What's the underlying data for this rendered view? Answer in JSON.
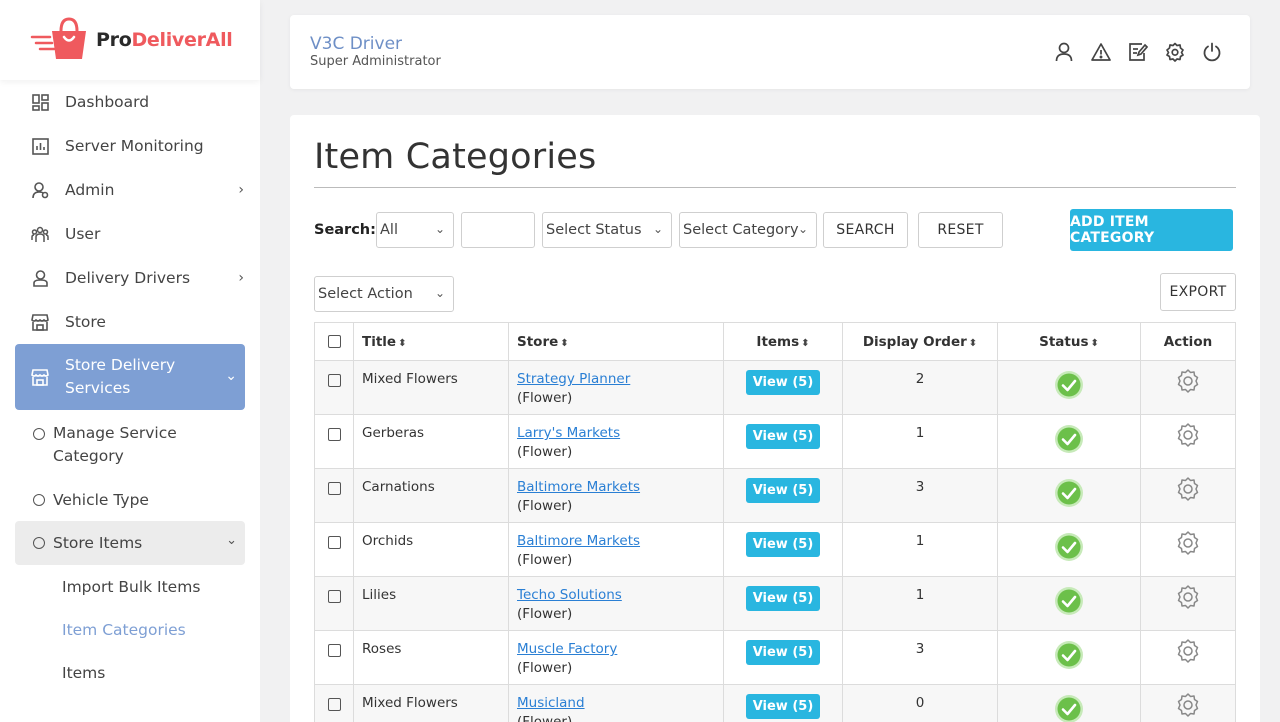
{
  "brand": {
    "part1": "Pro",
    "part2": "DeliverAll"
  },
  "sidebar": {
    "items": [
      {
        "label": "Dashboard",
        "icon": "dashboard-icon"
      },
      {
        "label": "Server Monitoring",
        "icon": "chart-icon"
      },
      {
        "label": "Admin",
        "icon": "admin-user-icon"
      },
      {
        "label": "User",
        "icon": "users-icon"
      },
      {
        "label": "Delivery Drivers",
        "icon": "driver-icon"
      },
      {
        "label": "Store",
        "icon": "store-icon"
      },
      {
        "label": "Store Delivery Services",
        "icon": "store-icon"
      }
    ],
    "sub": {
      "manage_service_category_1": "Manage Service",
      "manage_service_category_2": "Category",
      "vehicle_type": "Vehicle Type",
      "store_items": "Store Items"
    },
    "subsub": {
      "import_bulk_items": "Import Bulk Items",
      "item_categories": "Item Categories",
      "items": "Items"
    }
  },
  "header": {
    "user_name": "V3C Driver",
    "user_role": "Super Administrator"
  },
  "main": {
    "title": "Item Categories",
    "search_label": "Search:",
    "filter_all": "All",
    "search_placeholder": "",
    "select_status": "Select Status",
    "select_category": "Select Category",
    "search_button": "SEARCH",
    "reset_button": "RESET",
    "add_button": "ADD ITEM CATEGORY",
    "select_action": "Select Action",
    "export_button": "EXPORT"
  },
  "table": {
    "columns": {
      "title": "Title",
      "store": "Store",
      "items": "Items",
      "display_order": "Display Order",
      "status": "Status",
      "action": "Action"
    },
    "rows": [
      {
        "title": "Mixed Flowers",
        "store": "Strategy Planner",
        "category": "(Flower)",
        "items": "View (5)",
        "order": "2"
      },
      {
        "title": "Gerberas",
        "store": "Larry's Markets",
        "category": "(Flower)",
        "items": "View (5)",
        "order": "1"
      },
      {
        "title": "Carnations",
        "store": "Baltimore Markets",
        "category": "(Flower)",
        "items": "View (5)",
        "order": "3"
      },
      {
        "title": "Orchids",
        "store": "Baltimore Markets",
        "category": "(Flower)",
        "items": "View (5)",
        "order": "1"
      },
      {
        "title": "Lilies",
        "store": "Techo Solutions",
        "category": "(Flower)",
        "items": "View (5)",
        "order": "1"
      },
      {
        "title": "Roses",
        "store": "Muscle Factory",
        "category": "(Flower)",
        "items": "View (5)",
        "order": "3"
      },
      {
        "title": "Mixed Flowers",
        "store": "Musicland",
        "category": "(Flower)",
        "items": "View (5)",
        "order": "0"
      }
    ]
  },
  "colors": {
    "accent": "#7e9fd4",
    "primary_button": "#29b6e0",
    "brand_red": "#ef5a5e",
    "status_green": "#7ccc63"
  }
}
